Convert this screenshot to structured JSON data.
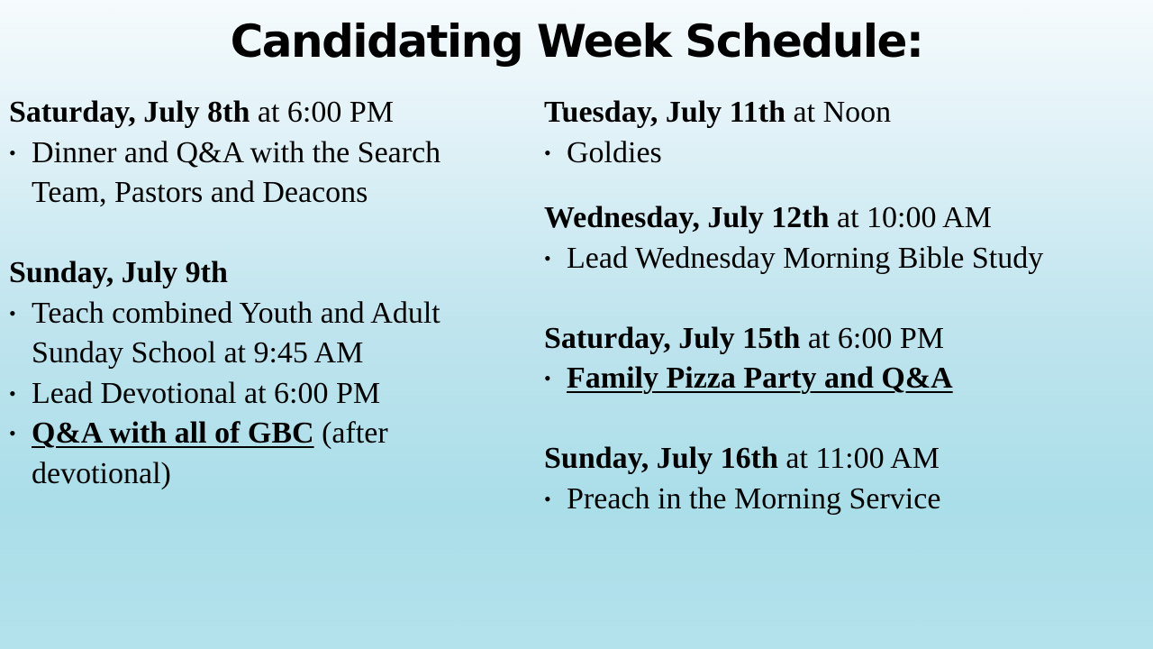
{
  "title": "Candidating Week Schedule:",
  "left_column": {
    "sat8": {
      "day": "Saturday, July 8th",
      "time": "at 6:00 PM",
      "item1_line1": "Dinner and Q&A with the Search",
      "item1_line2": "Team, Pastors and Deacons"
    },
    "sun9": {
      "day": "Sunday, July 9th",
      "item1_line1": "Teach combined Youth and Adult",
      "item1_line2": "Sunday School at 9:45 AM",
      "item2": "Lead Devotional  at 6:00 PM",
      "item3_bold": "Q&A with all of GBC",
      "item3_rest": "(after",
      "item3_line2": "devotional)"
    }
  },
  "right_column": {
    "tue11": {
      "day": "Tuesday, July 11th",
      "time": "at Noon",
      "item1": "Goldies"
    },
    "wed12": {
      "day": "Wednesday, July 12th",
      "time": "at 10:00 AM",
      "item1": "Lead Wednesday Morning Bible Study"
    },
    "sat15": {
      "day": "Saturday, July 15th",
      "time": "at 6:00 PM",
      "item1_bold": "Family Pizza  Party and Q&A"
    },
    "sun16": {
      "day": "Sunday, July 16th",
      "time": "at 11:00 AM",
      "item1": "Preach in the Morning Service"
    }
  },
  "bullet_char": "•"
}
